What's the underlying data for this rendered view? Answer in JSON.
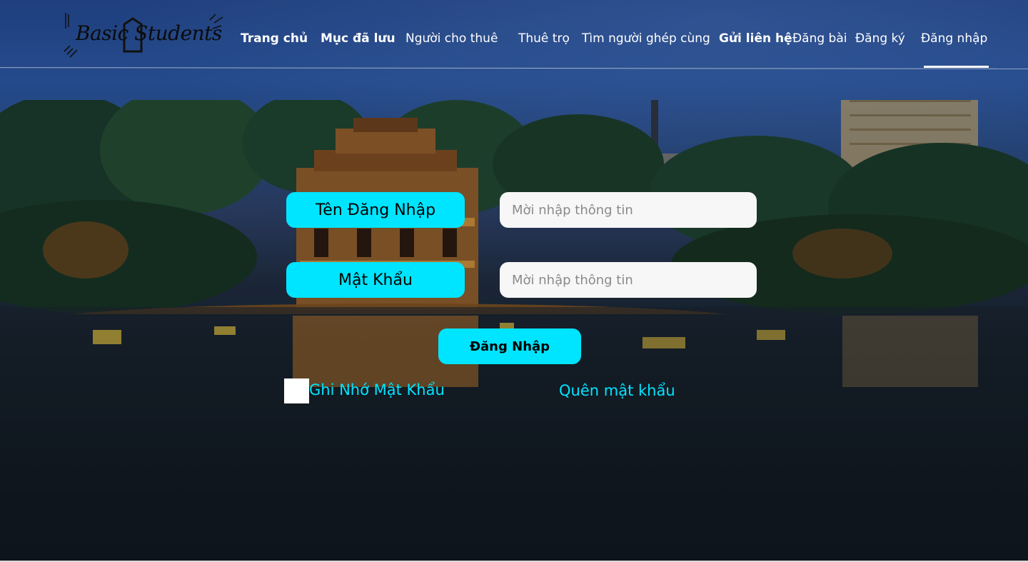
{
  "brand": {
    "logo_text": "Basic Students",
    "accent_color": "#00e5ff"
  },
  "nav": {
    "items": [
      {
        "label": "Trang chủ"
      },
      {
        "label": "Mục đã lưu"
      },
      {
        "label": "Người cho thuê"
      },
      {
        "label": "Thuê trọ"
      },
      {
        "label": "Tìm người ghép cùng"
      },
      {
        "label": "Gửi liên hệ"
      },
      {
        "label": "Đăng bài"
      },
      {
        "label": "Đăng ký"
      },
      {
        "label": "Đăng nhập"
      }
    ],
    "active": "Đăng nhập"
  },
  "form": {
    "username_label": "Tên Đăng Nhập",
    "username_placeholder": "Mời nhập thông tin",
    "password_label": "Mật Khẩu",
    "password_placeholder": "Mời nhập thông tin",
    "submit_label": "Đăng Nhập",
    "remember_label": "Ghi Nhớ Mật Khẩu",
    "forgot_label": "Quên mật khẩu"
  }
}
